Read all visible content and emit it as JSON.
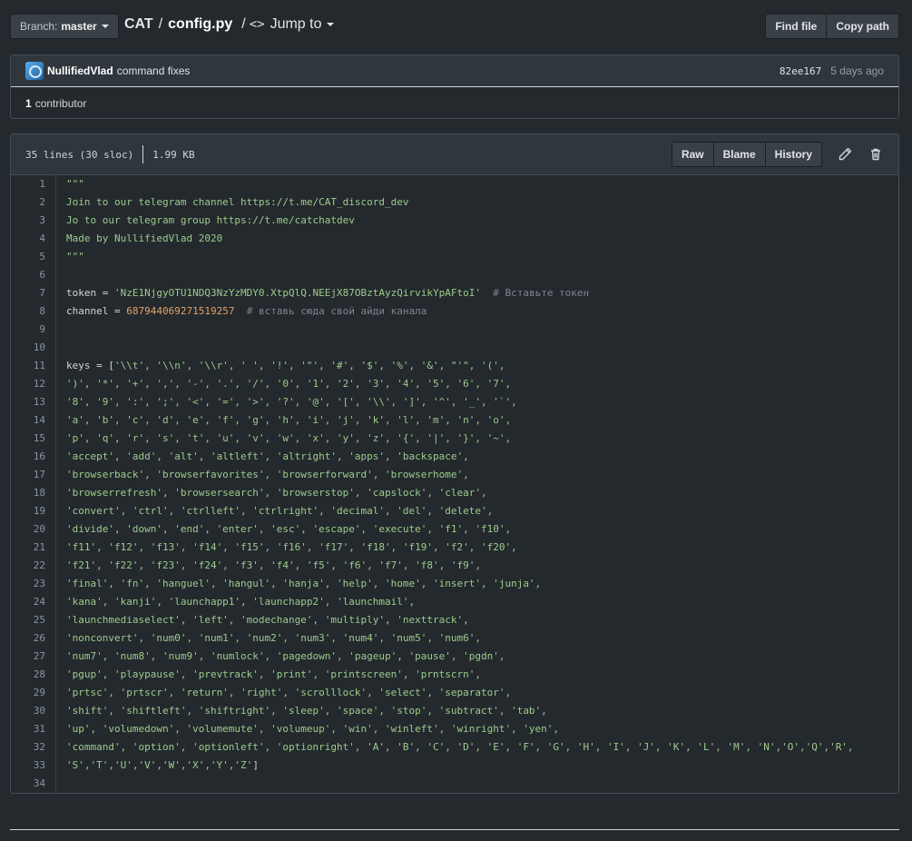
{
  "topbar": {
    "branch_label": "Branch:",
    "branch_value": "master",
    "repo": "CAT",
    "separator": "/",
    "file": "config.py",
    "jump_separator": "/",
    "jump_icon": "<>",
    "jump_label": "Jump to",
    "find_file": "Find file",
    "copy_path": "Copy path"
  },
  "commit": {
    "author": "NullifiedVlad",
    "message": "command fixes",
    "sha": "82ee167",
    "ago": "5 days ago",
    "contributors_count": "1",
    "contributors_label": "contributor"
  },
  "file": {
    "lines_info": "35 lines (30 sloc)",
    "size": "1.99 KB",
    "raw": "Raw",
    "blame": "Blame",
    "history": "History"
  },
  "code_lines": [
    {
      "n": "1",
      "t": "\"\"\"",
      "k": "str"
    },
    {
      "n": "2",
      "t": "Join to our telegram channel https://t.me/CAT_discord_dev",
      "k": "str"
    },
    {
      "n": "3",
      "t": "Jo to our telegram group https://t.me/catchatdev",
      "k": "str"
    },
    {
      "n": "4",
      "t": "Made by NullifiedVlad 2020",
      "k": "str"
    },
    {
      "n": "5",
      "t": "\"\"\"",
      "k": "str"
    },
    {
      "n": "6",
      "t": "",
      "k": "def"
    },
    {
      "n": "7",
      "t": "token = ",
      "t2": "'NzE1NjgyOTU1NDQ3NzYzMDY0.XtpQlQ.NEEjX87OBztAyzQirvikYpAFtoI'",
      "t3": "  # Вставьте токен",
      "k": "assign"
    },
    {
      "n": "8",
      "t": "channel = ",
      "t2": "687944069271519257",
      "t3": "  # вставь сюда свой айди канала",
      "k": "assignnum"
    },
    {
      "n": "9",
      "t": "",
      "k": "def"
    },
    {
      "n": "10",
      "t": "",
      "k": "def"
    },
    {
      "n": "11",
      "t": "keys = [",
      "t2": "'\\\\t', '\\\\n', '\\\\r', ' ', '!', '\"', '#', '$', '%', '&', \"'\", '(',",
      "k": "keys"
    },
    {
      "n": "12",
      "t": "')', '*', '+', ',', '-', '.', '/', '0', '1', '2', '3', '4', '5', '6', '7',",
      "k": "str"
    },
    {
      "n": "13",
      "t": "'8', '9', ':', ';', '<', '=', '>', '?', '@', '[', '\\\\', ']', '^', '_', '`',",
      "k": "str"
    },
    {
      "n": "14",
      "t": "'a', 'b', 'c', 'd', 'e', 'f', 'g', 'h', 'i', 'j', 'k', 'l', 'm', 'n', 'o',",
      "k": "str"
    },
    {
      "n": "15",
      "t": "'p', 'q', 'r', 's', 't', 'u', 'v', 'w', 'x', 'y', 'z', '{', '|', '}', '~',",
      "k": "str"
    },
    {
      "n": "16",
      "t": "'accept', 'add', 'alt', 'altleft', 'altright', 'apps', 'backspace',",
      "k": "str"
    },
    {
      "n": "17",
      "t": "'browserback', 'browserfavorites', 'browserforward', 'browserhome',",
      "k": "str"
    },
    {
      "n": "18",
      "t": "'browserrefresh', 'browsersearch', 'browserstop', 'capslock', 'clear',",
      "k": "str"
    },
    {
      "n": "19",
      "t": "'convert', 'ctrl', 'ctrlleft', 'ctrlright', 'decimal', 'del', 'delete',",
      "k": "str"
    },
    {
      "n": "20",
      "t": "'divide', 'down', 'end', 'enter', 'esc', 'escape', 'execute', 'f1', 'f10',",
      "k": "str"
    },
    {
      "n": "21",
      "t": "'f11', 'f12', 'f13', 'f14', 'f15', 'f16', 'f17', 'f18', 'f19', 'f2', 'f20',",
      "k": "str"
    },
    {
      "n": "22",
      "t": "'f21', 'f22', 'f23', 'f24', 'f3', 'f4', 'f5', 'f6', 'f7', 'f8', 'f9',",
      "k": "str"
    },
    {
      "n": "23",
      "t": "'final', 'fn', 'hanguel', 'hangul', 'hanja', 'help', 'home', 'insert', 'junja',",
      "k": "str"
    },
    {
      "n": "24",
      "t": "'kana', 'kanji', 'launchapp1', 'launchapp2', 'launchmail',",
      "k": "str"
    },
    {
      "n": "25",
      "t": "'launchmediaselect', 'left', 'modechange', 'multiply', 'nexttrack',",
      "k": "str"
    },
    {
      "n": "26",
      "t": "'nonconvert', 'num0', 'num1', 'num2', 'num3', 'num4', 'num5', 'num6',",
      "k": "str"
    },
    {
      "n": "27",
      "t": "'num7', 'num8', 'num9', 'numlock', 'pagedown', 'pageup', 'pause', 'pgdn',",
      "k": "str"
    },
    {
      "n": "28",
      "t": "'pgup', 'playpause', 'prevtrack', 'print', 'printscreen', 'prntscrn',",
      "k": "str"
    },
    {
      "n": "29",
      "t": "'prtsc', 'prtscr', 'return', 'right', 'scrolllock', 'select', 'separator',",
      "k": "str"
    },
    {
      "n": "30",
      "t": "'shift', 'shiftleft', 'shiftright', 'sleep', 'space', 'stop', 'subtract', 'tab',",
      "k": "str"
    },
    {
      "n": "31",
      "t": "'up', 'volumedown', 'volumemute', 'volumeup', 'win', 'winleft', 'winright', 'yen',",
      "k": "str"
    },
    {
      "n": "32",
      "t": "'command', 'option', 'optionleft', 'optionright', 'A', 'B', 'C', 'D', 'E', 'F', 'G', 'H', 'I', 'J', 'K', 'L', 'M', 'N','O','Q','R',",
      "k": "str"
    },
    {
      "n": "33",
      "t": "'S','T','U','V','W','X','Y','Z'",
      "t2": "]",
      "k": "strend"
    },
    {
      "n": "34",
      "t": "",
      "k": "def"
    }
  ]
}
